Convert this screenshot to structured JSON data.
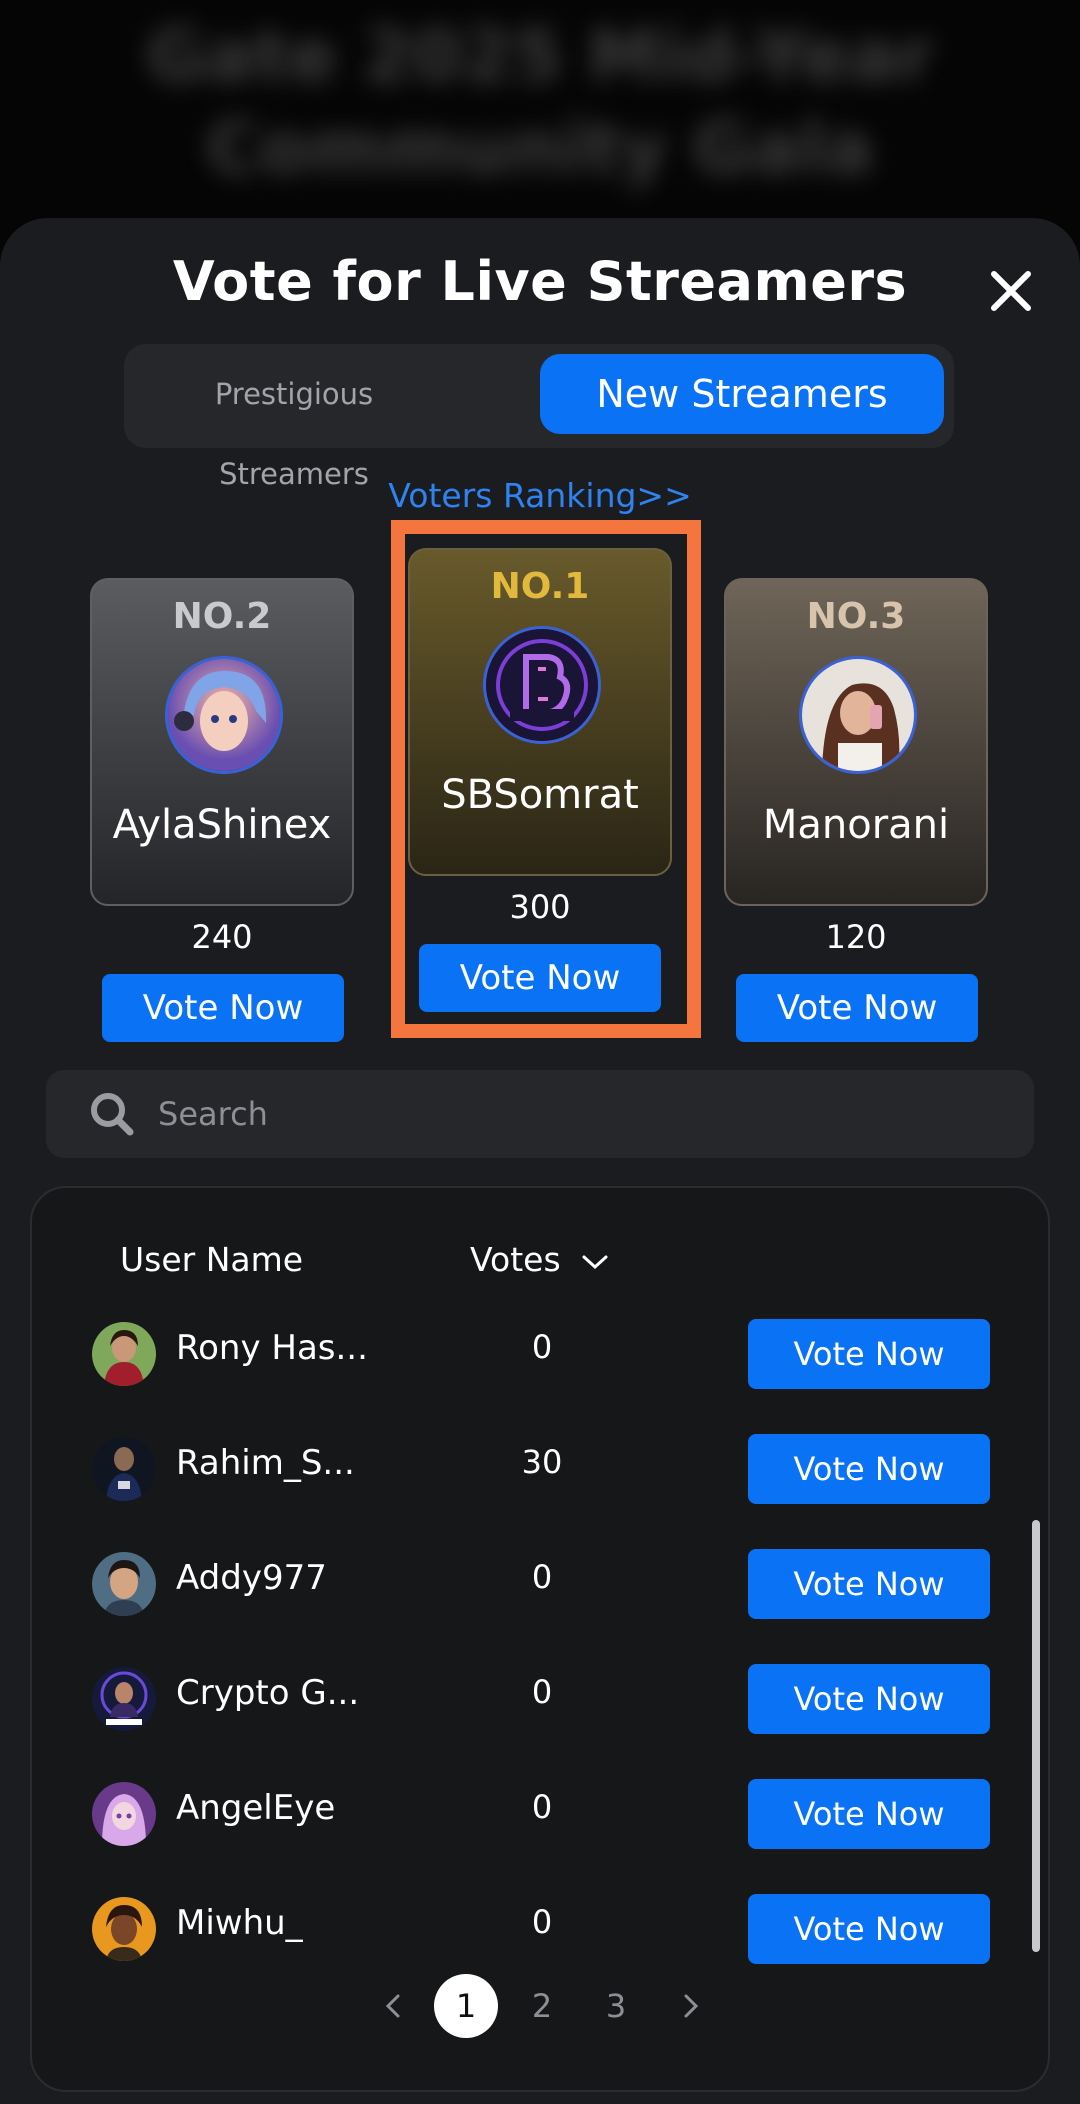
{
  "background": {
    "title": "Gate 2025 Mid-Year Community Gala"
  },
  "sheet": {
    "title": "Vote for Live Streamers"
  },
  "tabs": [
    {
      "label": "Prestigious Streamers",
      "active": false
    },
    {
      "label": "New Streamers",
      "active": true
    }
  ],
  "voters_ranking": "Voters Ranking>>",
  "podium": {
    "first": {
      "rank": "NO.1",
      "name": "SBSomrat",
      "votes": "300",
      "button": "Vote Now"
    },
    "second": {
      "rank": "NO.2",
      "name": "AylaShinex",
      "votes": "240",
      "button": "Vote Now"
    },
    "third": {
      "rank": "NO.3",
      "name": "Manorani",
      "votes": "120",
      "button": "Vote Now"
    }
  },
  "search": {
    "placeholder": "Search"
  },
  "table": {
    "headers": {
      "user": "User Name",
      "votes": "Votes"
    },
    "rows": [
      {
        "name": "Rony Has...",
        "votes": "0",
        "button": "Vote Now"
      },
      {
        "name": "Rahim_S...",
        "votes": "30",
        "button": "Vote Now"
      },
      {
        "name": "Addy977",
        "votes": "0",
        "button": "Vote Now"
      },
      {
        "name": "Crypto G...",
        "votes": "0",
        "button": "Vote Now"
      },
      {
        "name": "AngelEye",
        "votes": "0",
        "button": "Vote Now"
      },
      {
        "name": "Miwhu_",
        "votes": "0",
        "button": "Vote Now"
      }
    ]
  },
  "pagination": {
    "pages": [
      "1",
      "2",
      "3"
    ],
    "current": "1"
  },
  "colors": {
    "accent": "#0a72f5",
    "highlight": "#f5753e",
    "gold": "#e1b93c"
  },
  "icons": [
    "close-icon",
    "search-icon",
    "chevron-down-icon",
    "chevron-left-icon",
    "chevron-right-icon"
  ]
}
